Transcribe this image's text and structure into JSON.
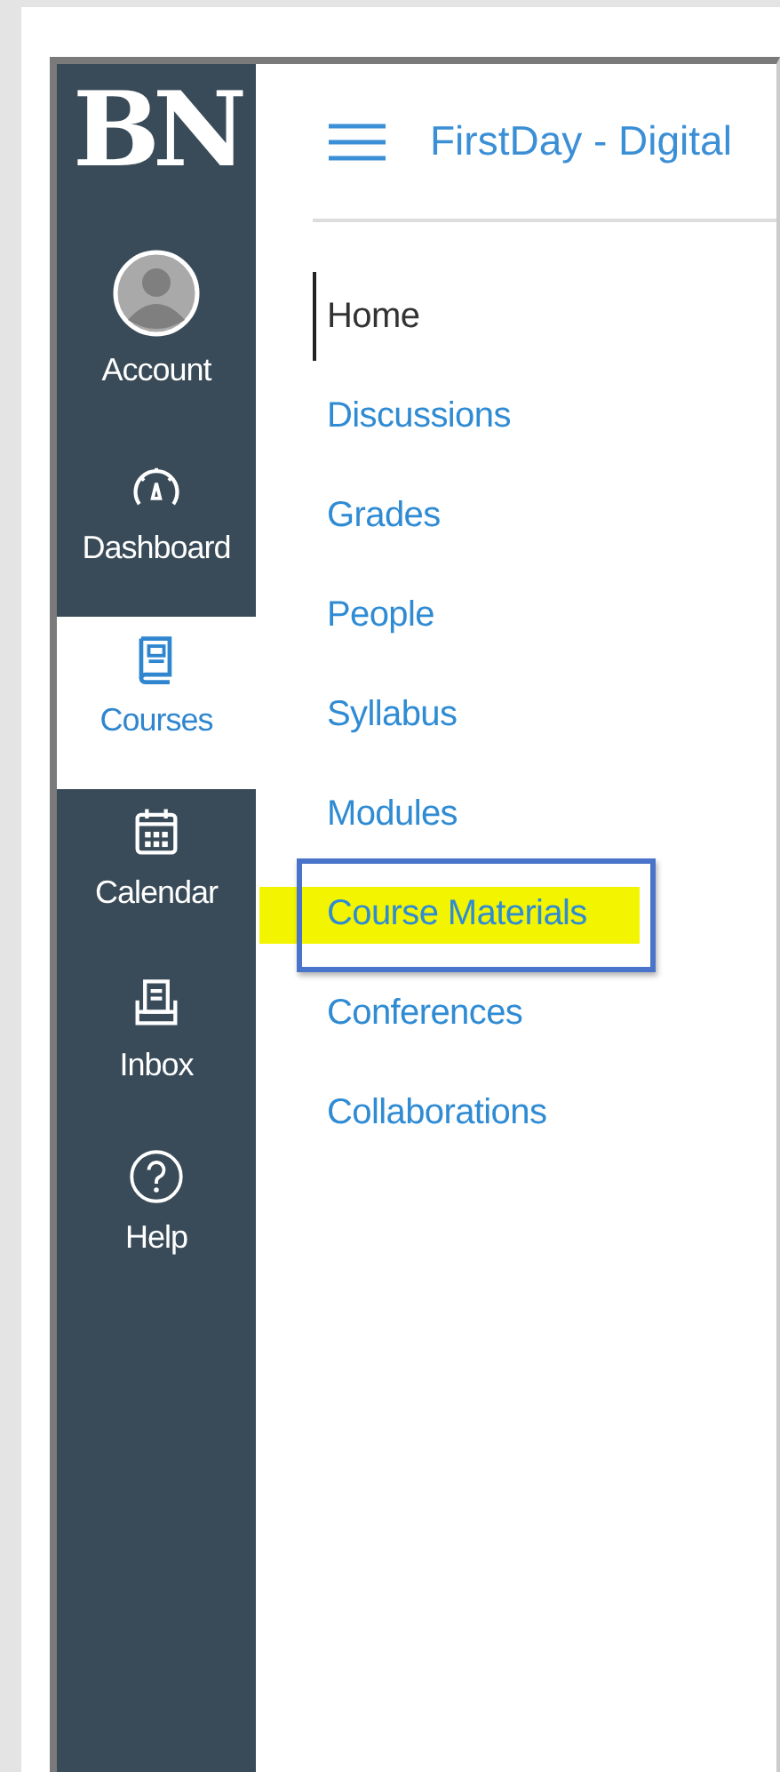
{
  "sidebar": {
    "logo": "BN",
    "items": [
      {
        "kind": "account",
        "label": "Account",
        "selected": false
      },
      {
        "kind": "dashboard",
        "label": "Dashboard",
        "selected": false
      },
      {
        "kind": "courses",
        "label": "Courses",
        "selected": true
      },
      {
        "kind": "calendar",
        "label": "Calendar",
        "selected": false
      },
      {
        "kind": "inbox",
        "label": "Inbox",
        "selected": false
      },
      {
        "kind": "help",
        "label": "Help",
        "selected": false
      }
    ]
  },
  "header": {
    "title": "FirstDay - Digital"
  },
  "course_nav": [
    {
      "label": "Home",
      "selected": true,
      "highlighted": false
    },
    {
      "label": "Discussions",
      "selected": false,
      "highlighted": false
    },
    {
      "label": "Grades",
      "selected": false,
      "highlighted": false
    },
    {
      "label": "People",
      "selected": false,
      "highlighted": false
    },
    {
      "label": "Syllabus",
      "selected": false,
      "highlighted": false
    },
    {
      "label": "Modules",
      "selected": false,
      "highlighted": false
    },
    {
      "label": "Course Materials",
      "selected": false,
      "highlighted": true
    },
    {
      "label": "Conferences",
      "selected": false,
      "highlighted": false
    },
    {
      "label": "Collaborations",
      "selected": false,
      "highlighted": false
    }
  ]
}
